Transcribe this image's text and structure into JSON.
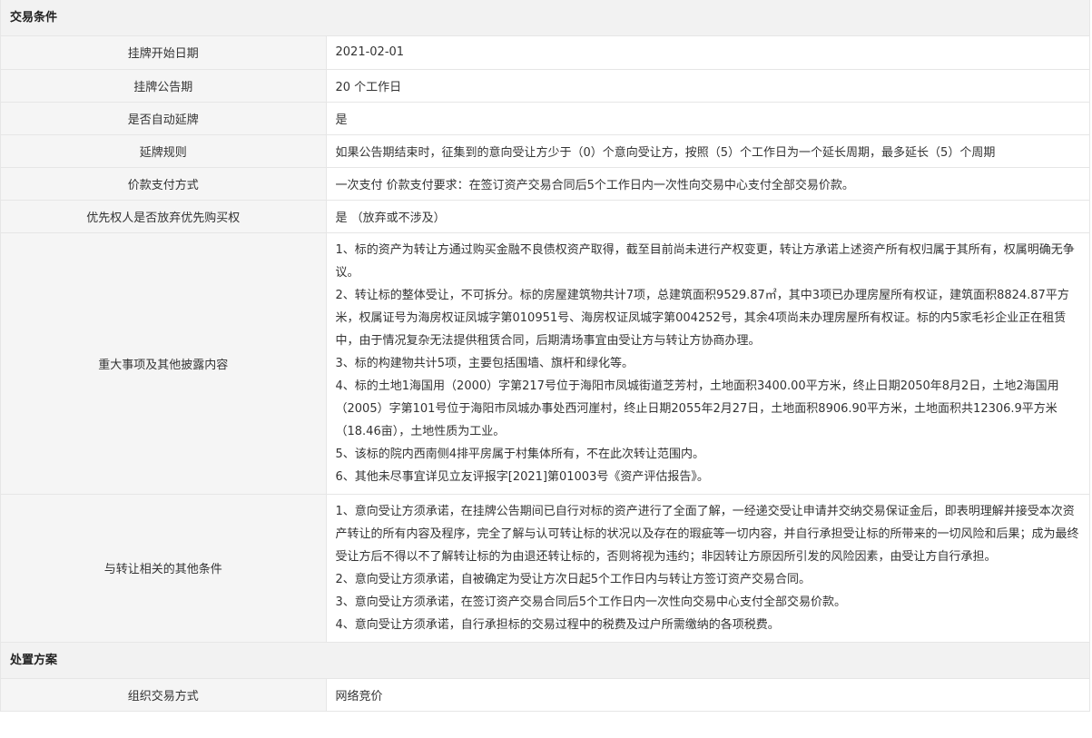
{
  "sections": {
    "trade": {
      "title": "交易条件"
    },
    "disposal": {
      "title": "处置方案"
    }
  },
  "rows": {
    "listing_start": {
      "label": "挂牌开始日期",
      "value": "2021-02-01"
    },
    "listing_period": {
      "label": "挂牌公告期",
      "value": "20 个工作日"
    },
    "auto_extend": {
      "label": "是否自动延牌",
      "value": "是"
    },
    "extend_rule": {
      "label": "延牌规则",
      "value": "如果公告期结束时，征集到的意向受让方少于（0）个意向受让方，按照（5）个工作日为一个延长周期，最多延长（5）个周期"
    },
    "payment": {
      "label": "价款支付方式",
      "value": "一次支付 价款支付要求：在签订资产交易合同后5个工作日内一次性向交易中心支付全部交易价款。"
    },
    "preemption": {
      "label": "优先权人是否放弃优先购买权",
      "value": "是 （放弃或不涉及）"
    },
    "disclosure": {
      "label": "重大事项及其他披露内容",
      "paragraphs": [
        "1、标的资产为转让方通过购买金融不良债权资产取得，截至目前尚未进行产权变更，转让方承诺上述资产所有权归属于其所有，权属明确无争议。",
        "2、转让标的整体受让，不可拆分。标的房屋建筑物共计7项，总建筑面积9529.87㎡，其中3项已办理房屋所有权证，建筑面积8824.87平方米，权属证号为海房权证凤城字第010951号、海房权证凤城字第004252号，其余4项尚未办理房屋所有权证。标的内5家毛衫企业正在租赁中，由于情况复杂无法提供租赁合同，后期清场事宜由受让方与转让方协商办理。",
        "3、标的构建物共计5项，主要包括围墙、旗杆和绿化等。",
        "4、标的土地1海国用（2000）字第217号位于海阳市凤城街道芝芳村，土地面积3400.00平方米，终止日期2050年8月2日，土地2海国用（2005）字第101号位于海阳市凤城办事处西河崖村，终止日期2055年2月27日，土地面积8906.90平方米，土地面积共12306.9平方米（18.46亩），土地性质为工业。",
        "5、该标的院内西南侧4排平房属于村集体所有，不在此次转让范围内。",
        "6、其他未尽事宜详见立友评报字[2021]第01003号《资产评估报告》。"
      ]
    },
    "other_conditions": {
      "label": "与转让相关的其他条件",
      "paragraphs": [
        "1、意向受让方须承诺，在挂牌公告期间已自行对标的资产进行了全面了解，一经递交受让申请并交纳交易保证金后，即表明理解并接受本次资产转让的所有内容及程序，完全了解与认可转让标的状况以及存在的瑕疵等一切内容，并自行承担受让标的所带来的一切风险和后果；成为最终受让方后不得以不了解转让标的为由退还转让标的，否则将视为违约；非因转让方原因所引发的风险因素，由受让方自行承担。",
        "2、意向受让方须承诺，自被确定为受让方次日起5个工作日内与转让方签订资产交易合同。",
        "3、意向受让方须承诺，在签订资产交易合同后5个工作日内一次性向交易中心支付全部交易价款。",
        "4、意向受让方须承诺，自行承担标的交易过程中的税费及过户所需缴纳的各项税费。"
      ]
    },
    "trade_method": {
      "label": "组织交易方式",
      "value": "网络竞价"
    }
  }
}
